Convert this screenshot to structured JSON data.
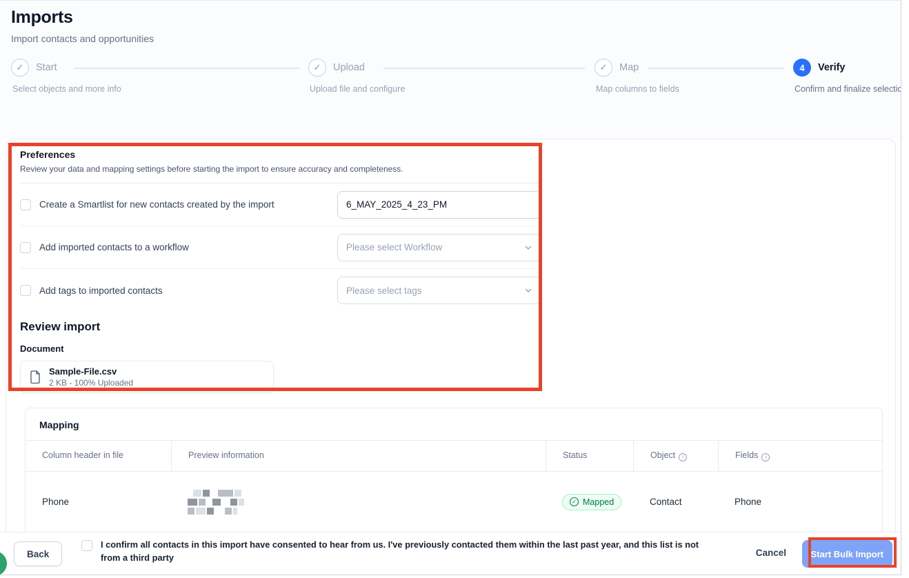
{
  "header": {
    "title": "Imports",
    "subtitle": "Import contacts and opportunities"
  },
  "stepper": {
    "steps": [
      {
        "label": "Start",
        "sublabel": "Select objects and more info",
        "state": "complete"
      },
      {
        "label": "Upload",
        "sublabel": "Upload file and configure",
        "state": "complete"
      },
      {
        "label": "Map",
        "sublabel": "Map columns to fields",
        "state": "complete"
      },
      {
        "label": "Verify",
        "sublabel": "Confirm and finalize selection",
        "state": "active",
        "number": "4"
      }
    ]
  },
  "preferences": {
    "title": "Preferences",
    "description": "Review your data and mapping settings before starting the import to ensure accuracy and completeness.",
    "options": [
      {
        "label": "Create a Smartlist for new contacts created by the import",
        "control": "input",
        "value": "6_MAY_2025_4_23_PM"
      },
      {
        "label": "Add imported contacts to a workflow",
        "control": "select",
        "placeholder": "Please select Workflow"
      },
      {
        "label": "Add tags to imported contacts",
        "control": "select",
        "placeholder": "Please select tags"
      }
    ]
  },
  "review": {
    "title": "Review import",
    "document_label": "Document",
    "file": {
      "name": "Sample-File.csv",
      "meta": "2 KB - 100% Uploaded"
    }
  },
  "mapping": {
    "title": "Mapping",
    "columns": [
      "Column header in file",
      "Preview information",
      "Status",
      "Object",
      "Fields"
    ],
    "rows": [
      {
        "column_header": "Phone",
        "preview": "(redacted)",
        "status": "Mapped",
        "object": "Contact",
        "fields": "Phone"
      }
    ]
  },
  "footer": {
    "back_label": "Back",
    "consent_text": "I confirm all contacts in this import have consented to hear from us. I've previously contacted them within the last past year, and this list is not from a third party",
    "cancel_label": "Cancel",
    "start_label": "Start Bulk Import"
  },
  "icons": {
    "step_check": "✓",
    "mapped_check": "✓",
    "info": "i"
  },
  "colors": {
    "primary_blue": "#2970ff",
    "start_button_blue": "#7ea3f8",
    "annotation_red": "#e8432a",
    "badge_green_text": "#067647",
    "badge_green_bg": "#ecfdf3",
    "help_bubble_green": "#2ba36a"
  }
}
